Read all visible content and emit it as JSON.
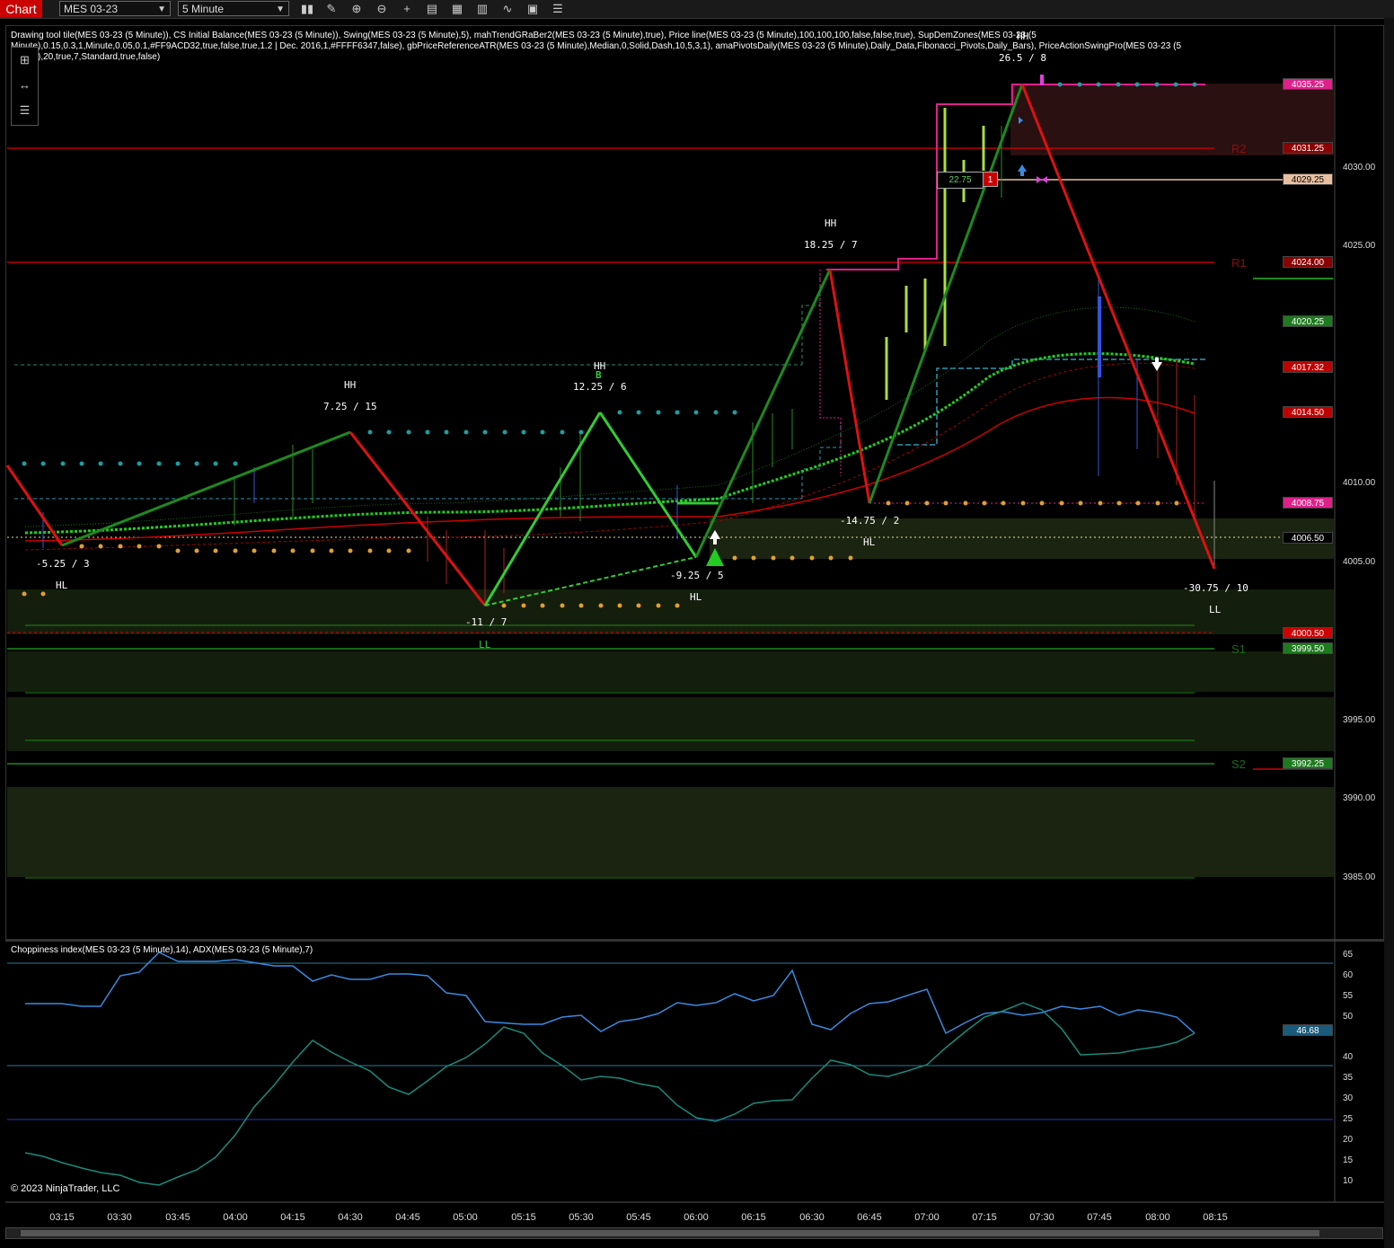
{
  "toolbar": {
    "tab_label": "Chart",
    "instrument": "MES 03-23",
    "interval": "5 Minute"
  },
  "price_panel": {
    "legend_line1": "Drawing tool tile(MES 03-23 (5 Minute)), CS Initial Balance(MES 03-23 (5 Minute)), Swing(MES 03-23 (5 Minute),5), mahTrendGRaBer2(MES 03-23 (5 Minute),true), Price line(MES 03-23 (5 Minute),100,100,100,false,false,true), SupDemZones(MES 03-23 (5",
    "legend_line2": "Minute),0.15,0.3,1,Minute,0.05,0.1,#FF9ACD32,true,false,true,1.2 | Dec. 2016,1,#FFFF6347,false), gbPriceReferenceATR(MES 03-23 (5 Minute),Median,0,Solid,Dash,10,5,3,1), amaPivotsDaily(MES 03-23 (5 Minute),Daily_Data,Fibonacci_Pivots,Daily_Bars), PriceActionSwingPro(MES 03-23 (5",
    "legend_line3": "Minute),20,true,7,Standard,true,false)",
    "axis_ticks": [
      "4030.00",
      "4025.00",
      "4010.00",
      "4005.00",
      "3995.00",
      "3990.00",
      "3985.00"
    ],
    "price_tags": [
      {
        "value": "4035.25",
        "bg": "#e0208a",
        "fg": "#ffffff"
      },
      {
        "value": "4031.25",
        "bg": "#8b0000",
        "fg": "#ffffff"
      },
      {
        "value": "4029.25",
        "bg": "#e8c0a0",
        "fg": "#000000"
      },
      {
        "value": "4024.00",
        "bg": "#8b0000",
        "fg": "#ffffff"
      },
      {
        "value": "4020.25",
        "bg": "#1e7a1e",
        "fg": "#ffffff"
      },
      {
        "value": "4017.32",
        "bg": "#c00000",
        "fg": "#ffffff"
      },
      {
        "value": "4014.50",
        "bg": "#c00000",
        "fg": "#ffffff"
      },
      {
        "value": "4008.75",
        "bg": "#e0208a",
        "fg": "#ffffff"
      },
      {
        "value": "4006.50",
        "bg": "#000000",
        "fg": "#ffffff"
      },
      {
        "value": "4000.50",
        "bg": "#d00000",
        "fg": "#ffffff"
      },
      {
        "value": "3999.50",
        "bg": "#1e7a1e",
        "fg": "#ffffff"
      },
      {
        "value": "3992.25",
        "bg": "#1e7a1e",
        "fg": "#ffffff"
      }
    ],
    "pivots": {
      "r2": "R2",
      "r1": "R1",
      "s1": "S1",
      "s2": "S2"
    },
    "swing_labels": [
      {
        "text": "-5.25 / 3"
      },
      {
        "text": "HL"
      },
      {
        "text": "HH"
      },
      {
        "text": "7.25 / 15"
      },
      {
        "text": "-11 / 7"
      },
      {
        "text": "LL"
      },
      {
        "text": "HH"
      },
      {
        "text": "12.25 / 6"
      },
      {
        "text": "B"
      },
      {
        "text": "-9.25 / 5"
      },
      {
        "text": "HL"
      },
      {
        "text": "HH"
      },
      {
        "text": "18.25 / 7"
      },
      {
        "text": "-14.75 / 2"
      },
      {
        "text": "HL"
      },
      {
        "text": "HH"
      },
      {
        "text": "26.5 / 8"
      },
      {
        "text": "-30.75 / 10"
      },
      {
        "text": "LL"
      }
    ],
    "position_box": {
      "pnl": "22.75",
      "qty": "1"
    }
  },
  "indicator_panel": {
    "legend": "Choppiness index(MES 03-23 (5 Minute),14), ADX(MES 03-23 (5 Minute),7)",
    "axis_ticks": [
      "65",
      "60",
      "55",
      "50",
      "40",
      "35",
      "30",
      "25",
      "20",
      "15",
      "10"
    ],
    "value_tag": "46.68"
  },
  "time_axis": [
    "03:15",
    "03:30",
    "03:45",
    "04:00",
    "04:15",
    "04:30",
    "04:45",
    "05:00",
    "05:15",
    "05:30",
    "05:45",
    "06:00",
    "06:15",
    "06:30",
    "06:45",
    "07:00",
    "07:15",
    "07:30",
    "07:45",
    "08:00",
    "08:15"
  ],
  "copyright": "© 2023 NinjaTrader, LLC"
}
